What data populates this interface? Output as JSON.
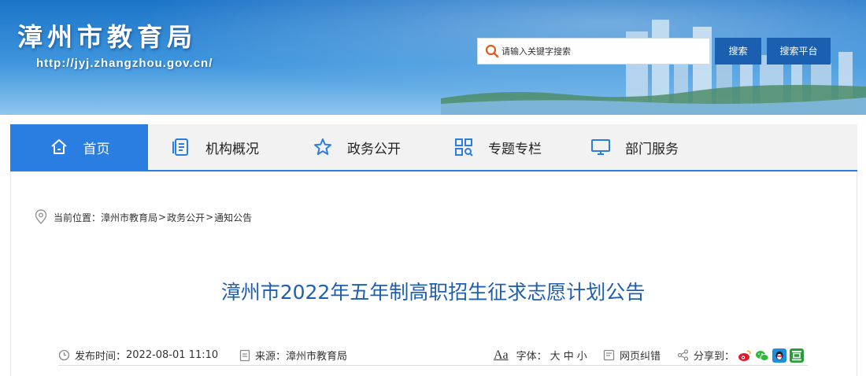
{
  "header": {
    "title": "漳州市教育局",
    "url": "http://jyj.zhangzhou.gov.cn/",
    "search_placeholder": "请输入关键字搜索",
    "search_button": "搜索",
    "platform_button": "搜索平台"
  },
  "nav": [
    {
      "label": "首页",
      "icon": "home-icon"
    },
    {
      "label": "机构概况",
      "icon": "document-list-icon"
    },
    {
      "label": "政务公开",
      "icon": "star-icon"
    },
    {
      "label": "专题专栏",
      "icon": "grid-search-icon"
    },
    {
      "label": "部门服务",
      "icon": "monitor-icon"
    }
  ],
  "breadcrumb": {
    "prefix": "当前位置：",
    "items": [
      "漳州市教育局",
      "政务公开",
      "通知公告"
    ],
    "separator": ">"
  },
  "article": {
    "title": "漳州市2022年五年制高职招生征求志愿计划公告"
  },
  "meta": {
    "date_label": "发布时间：",
    "date": "2022-08-01 11:10",
    "source_label": "来源：",
    "source": "漳州市教育局",
    "font_icon_text": "Aa",
    "font_label": "字体：",
    "font_sizes": [
      "大",
      "中",
      "小"
    ],
    "error_label": "网页纠错",
    "share_label": "分享到：",
    "share_targets": [
      "weibo-icon",
      "wechat-icon",
      "qq-icon",
      "douban-icon"
    ]
  }
}
